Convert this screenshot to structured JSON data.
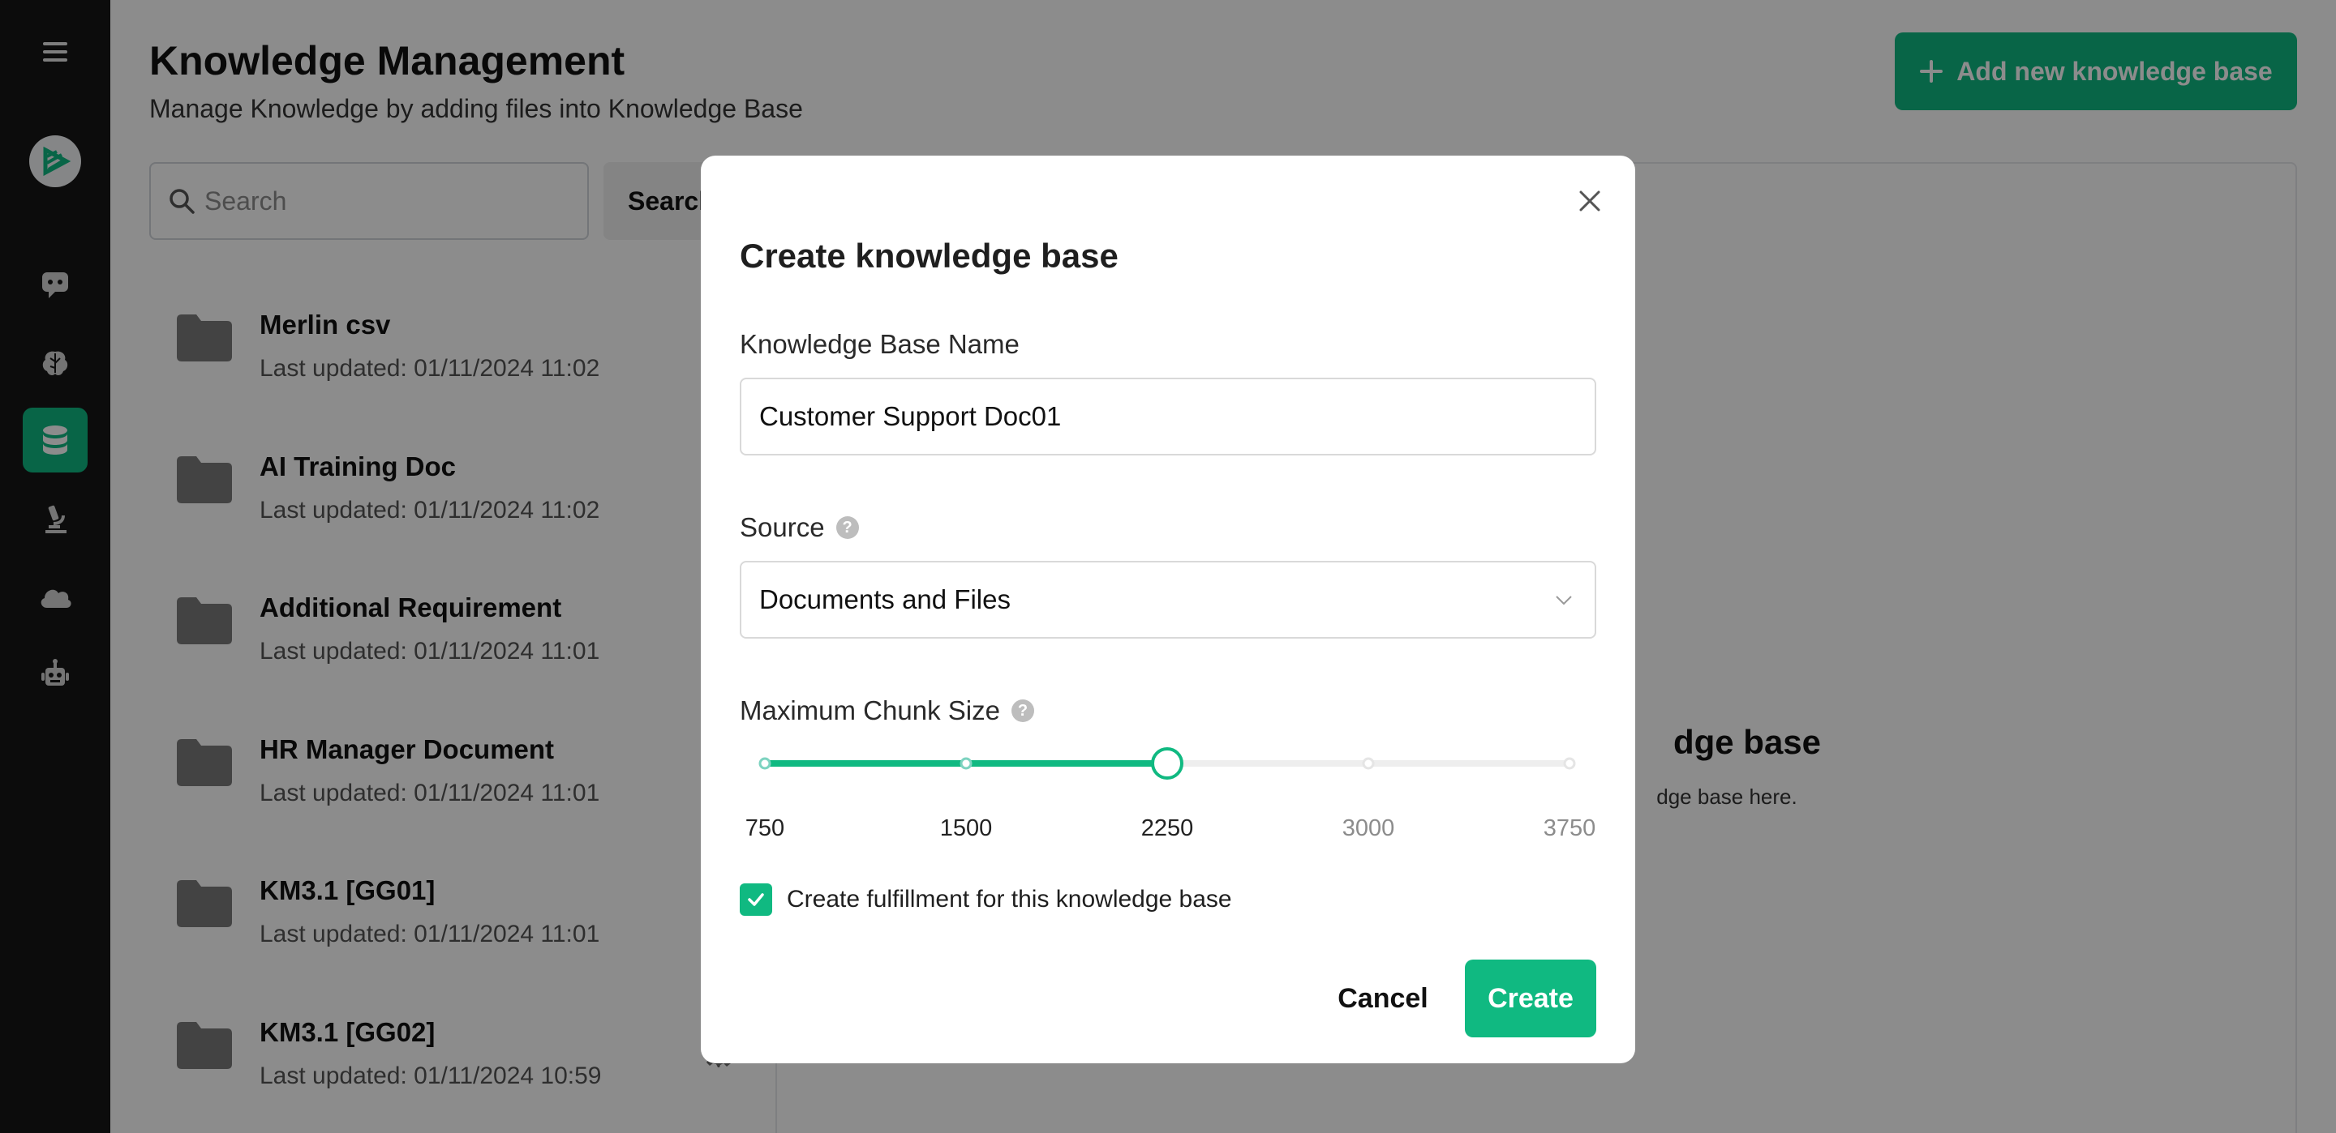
{
  "sidebar": {
    "icons": [
      "menu-icon",
      "logo-icon",
      "chatbot-icon",
      "brain-icon",
      "database-icon",
      "microscope-icon",
      "cloud-icon",
      "robot-icon"
    ],
    "active": "database-icon",
    "accent": "#10b981"
  },
  "header": {
    "title": "Knowledge Management",
    "subtitle": "Manage Knowledge by adding files into Knowledge Base",
    "add_button_label": "Add new knowledge base"
  },
  "search": {
    "placeholder": "Search",
    "button_label": "Search"
  },
  "knowledge_bases": [
    {
      "name": "Merlin csv",
      "updated": "Last updated: 01/11/2024 11:02"
    },
    {
      "name": "AI Training Doc",
      "updated": "Last updated: 01/11/2024 11:02"
    },
    {
      "name": "Additional Requirement",
      "updated": "Last updated: 01/11/2024 11:01"
    },
    {
      "name": "HR Manager Document",
      "updated": "Last updated: 01/11/2024 11:01"
    },
    {
      "name": "KM3.1 [GG01]",
      "updated": "Last updated: 01/11/2024 11:01"
    },
    {
      "name": "KM3.1 [GG02]",
      "updated": "Last updated: 01/11/2024 10:59"
    }
  ],
  "empty_state": {
    "title_visible": "dge base",
    "description_visible": "dge base here."
  },
  "modal": {
    "title": "Create knowledge base",
    "name_label": "Knowledge Base Name",
    "name_value": "Customer Support Doc01",
    "source_label": "Source",
    "source_help": "?",
    "source_value": "Documents and Files",
    "chunk_label": "Maximum Chunk Size",
    "chunk_help": "?",
    "chunk_marks": [
      "750",
      "1500",
      "2250",
      "3000",
      "3750"
    ],
    "chunk_value": 2250,
    "chunk_min": 750,
    "chunk_max": 3750,
    "fulfillment_checked": true,
    "fulfillment_label": "Create fulfillment for this knowledge base",
    "cancel_label": "Cancel",
    "create_label": "Create"
  }
}
